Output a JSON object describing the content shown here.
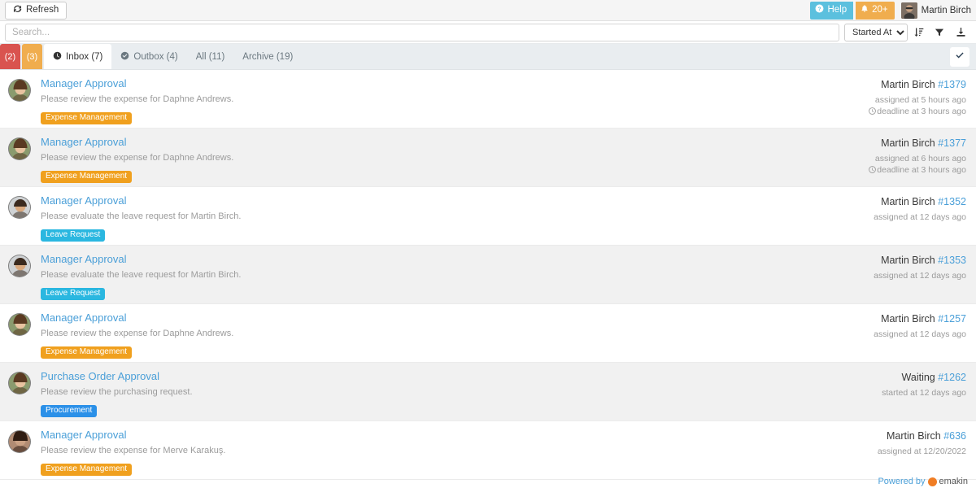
{
  "topbar": {
    "refresh_label": "Refresh",
    "refresh_icon": "refresh-icon",
    "help_label": "Help",
    "help_icon": "question-circle-icon",
    "help_color": "#5bc0de",
    "notification_count": "20+",
    "notification_icon": "bell-icon",
    "notification_color": "#f0ad4e",
    "user_name": "Martin Birch",
    "avatar_icon": "user-avatar"
  },
  "search": {
    "value": "",
    "placeholder": "Search...",
    "sort_field": "Started At",
    "sort_options": [
      "Started At"
    ],
    "sort_order_icon": "sort-descending-icon",
    "filter_icon": "filter-icon",
    "export_icon": "download-icon"
  },
  "tabs": {
    "badges": [
      {
        "label": "(2)",
        "color": "#d9534f",
        "name": "overdue-count-badge"
      },
      {
        "label": "(3)",
        "color": "#f0ad4e",
        "name": "due-soon-count-badge"
      }
    ],
    "items": [
      {
        "label": "Inbox (7)",
        "icon": "clock-icon",
        "active": true
      },
      {
        "label": "Outbox (4)",
        "icon": "check-circle-icon",
        "active": false
      },
      {
        "label": "All (11)",
        "icon": "",
        "active": false
      },
      {
        "label": "Archive (19)",
        "icon": "",
        "active": false
      }
    ],
    "select_all_icon": "check-icon"
  },
  "list": [
    {
      "title": "Manager Approval",
      "description": "Please review the expense for Daphne Andrews.",
      "tag": "Expense Management",
      "tag_class": "tag-expense",
      "assignee": "Martin Birch",
      "number": "#1379",
      "meta1": "assigned at 5 hours ago",
      "meta2": "deadline at 3 hours ago",
      "meta2_icon": "clock-icon",
      "avatar": "avatar-daphne"
    },
    {
      "title": "Manager Approval",
      "description": "Please review the expense for Daphne Andrews.",
      "tag": "Expense Management",
      "tag_class": "tag-expense",
      "assignee": "Martin Birch",
      "number": "#1377",
      "meta1": "assigned at 6 hours ago",
      "meta2": "deadline at 3 hours ago",
      "meta2_icon": "clock-icon",
      "avatar": "avatar-daphne"
    },
    {
      "title": "Manager Approval",
      "description": "Please evaluate the leave request for Martin Birch.",
      "tag": "Leave Request",
      "tag_class": "tag-leave",
      "assignee": "Martin Birch",
      "number": "#1352",
      "meta1": "assigned at 12 days ago",
      "meta2": "",
      "meta2_icon": "",
      "avatar": "avatar-martin"
    },
    {
      "title": "Manager Approval",
      "description": "Please evaluate the leave request for Martin Birch.",
      "tag": "Leave Request",
      "tag_class": "tag-leave",
      "assignee": "Martin Birch",
      "number": "#1353",
      "meta1": "assigned at 12 days ago",
      "meta2": "",
      "meta2_icon": "",
      "avatar": "avatar-martin"
    },
    {
      "title": "Manager Approval",
      "description": "Please review the expense for Daphne Andrews.",
      "tag": "Expense Management",
      "tag_class": "tag-expense",
      "assignee": "Martin Birch",
      "number": "#1257",
      "meta1": "assigned at 12 days ago",
      "meta2": "",
      "meta2_icon": "",
      "avatar": "avatar-daphne"
    },
    {
      "title": "Purchase Order Approval",
      "description": "Please review the purchasing request.",
      "tag": "Procurement",
      "tag_class": "tag-procurement",
      "assignee": "Waiting",
      "number": "#1262",
      "meta1": "started at 12 days ago",
      "meta2": "",
      "meta2_icon": "",
      "avatar": "avatar-daphne"
    },
    {
      "title": "Manager Approval",
      "description": "Please review the expense for Merve Karakuş.",
      "tag": "Expense Management",
      "tag_class": "tag-expense",
      "assignee": "Martin Birch",
      "number": "#636",
      "meta1": "assigned at 12/20/2022",
      "meta2": "",
      "meta2_icon": "",
      "avatar": "avatar-merve"
    }
  ],
  "footer": {
    "powered_by": "Powered by",
    "brand": "emakin",
    "brand_icon": "emakin-logo"
  }
}
